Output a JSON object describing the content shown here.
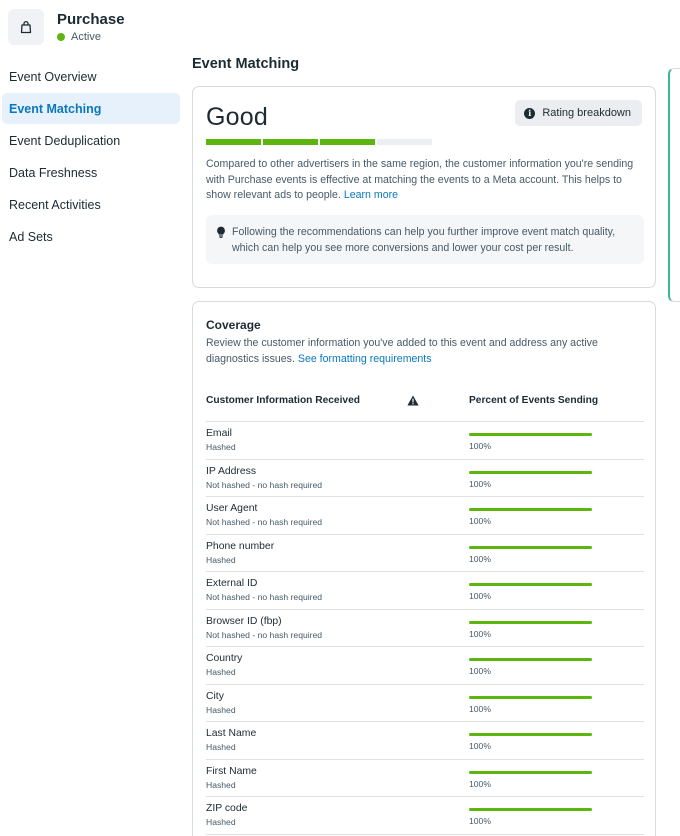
{
  "header": {
    "icon": "shopping-bag-icon",
    "title": "Purchase",
    "status": "Active",
    "status_color": "#5fb50f"
  },
  "sidebar": {
    "items": [
      {
        "label": "Event Overview",
        "active": false
      },
      {
        "label": "Event Matching",
        "active": true
      },
      {
        "label": "Event Deduplication",
        "active": false
      },
      {
        "label": "Data Freshness",
        "active": false
      },
      {
        "label": "Recent Activities",
        "active": false
      },
      {
        "label": "Ad Sets",
        "active": false
      }
    ]
  },
  "main": {
    "title": "Event Matching",
    "quality": {
      "rating": "Good",
      "rating_button": "Rating breakdown",
      "segments_filled": 3,
      "segments_total": 4,
      "description": "Compared to other advertisers in the same region, the customer information you're sending with Purchase events is effective at matching the events to a Meta account. This helps to show relevant ads to people.",
      "learn_more": "Learn more",
      "tip": "Following the recommendations can help you further improve event match quality, which can help you see more conversions and lower your cost per result."
    },
    "coverage": {
      "title": "Coverage",
      "description": "Review the customer information you've added to this event and address any active diagnostics issues.",
      "link": "See formatting requirements",
      "col_info": "Customer Information Received",
      "col_percent": "Percent of Events Sending",
      "rows": [
        {
          "name": "Email",
          "sub": "Hashed",
          "value": "100%",
          "percent": 100
        },
        {
          "name": "IP Address",
          "sub": "Not hashed - no hash required",
          "value": "100%",
          "percent": 100
        },
        {
          "name": "User Agent",
          "sub": "Not hashed - no hash required",
          "value": "100%",
          "percent": 100
        },
        {
          "name": "Phone number",
          "sub": "Hashed",
          "value": "100%",
          "percent": 100
        },
        {
          "name": "External ID",
          "sub": "Not hashed - no hash required",
          "value": "100%",
          "percent": 100
        },
        {
          "name": "Browser ID (fbp)",
          "sub": "Not hashed - no hash required",
          "value": "100%",
          "percent": 100
        },
        {
          "name": "Country",
          "sub": "Hashed",
          "value": "100%",
          "percent": 100
        },
        {
          "name": "City",
          "sub": "Hashed",
          "value": "100%",
          "percent": 100
        },
        {
          "name": "Last Name",
          "sub": "Hashed",
          "value": "100%",
          "percent": 100
        },
        {
          "name": "First Name",
          "sub": "Hashed",
          "value": "100%",
          "percent": 100
        },
        {
          "name": "ZIP code",
          "sub": "Hashed",
          "value": "100%",
          "percent": 100
        }
      ]
    }
  },
  "colors": {
    "accent": "#0a78be",
    "success": "#5fb50f",
    "active_bg": "#e7f1fc"
  }
}
